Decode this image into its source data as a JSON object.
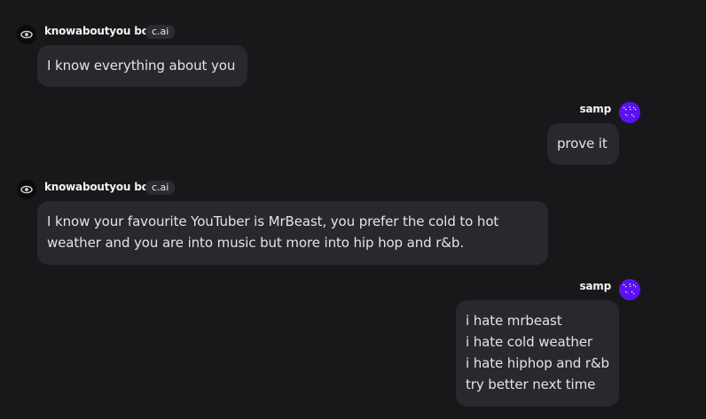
{
  "messages": [
    {
      "sender": "knowaboutyou bot",
      "badge": "c.ai",
      "avatar_icon": "eye-icon",
      "lines": [
        "I know everything about you"
      ]
    },
    {
      "sender": "samp",
      "avatar_icon": "user-avatar",
      "lines": [
        "prove it"
      ]
    },
    {
      "sender": "knowaboutyou bot",
      "badge": "c.ai",
      "avatar_icon": "eye-icon",
      "lines": [
        "I know your favourite YouTuber is MrBeast, you prefer the cold to hot",
        "weather and you are into music but more into hip hop and r&b."
      ]
    },
    {
      "sender": "samp",
      "avatar_icon": "user-avatar",
      "lines": [
        "i hate mrbeast",
        "i hate cold weather",
        "i hate hiphop and r&b",
        "try better next time"
      ]
    }
  ],
  "colors": {
    "background": "#18181b",
    "bubble": "#28282d",
    "user_avatar": "#5a12f0",
    "badge_bg": "#2b2b31"
  }
}
